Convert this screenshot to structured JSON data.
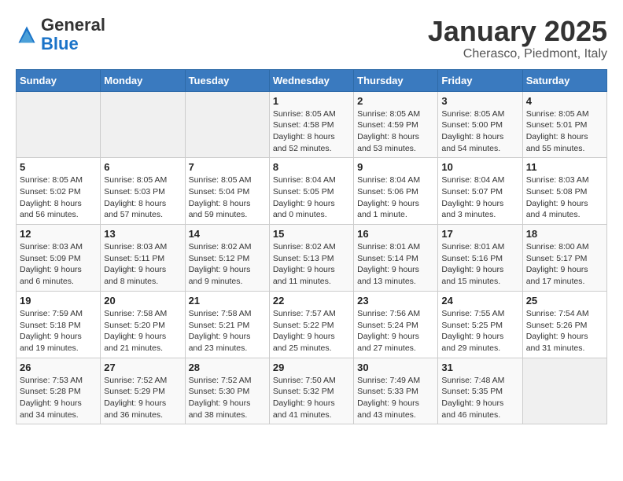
{
  "header": {
    "logo_general": "General",
    "logo_blue": "Blue",
    "title": "January 2025",
    "subtitle": "Cherasco, Piedmont, Italy"
  },
  "weekdays": [
    "Sunday",
    "Monday",
    "Tuesday",
    "Wednesday",
    "Thursday",
    "Friday",
    "Saturday"
  ],
  "weeks": [
    [
      {
        "day": "",
        "info": ""
      },
      {
        "day": "",
        "info": ""
      },
      {
        "day": "",
        "info": ""
      },
      {
        "day": "1",
        "info": "Sunrise: 8:05 AM\nSunset: 4:58 PM\nDaylight: 8 hours and 52 minutes."
      },
      {
        "day": "2",
        "info": "Sunrise: 8:05 AM\nSunset: 4:59 PM\nDaylight: 8 hours and 53 minutes."
      },
      {
        "day": "3",
        "info": "Sunrise: 8:05 AM\nSunset: 5:00 PM\nDaylight: 8 hours and 54 minutes."
      },
      {
        "day": "4",
        "info": "Sunrise: 8:05 AM\nSunset: 5:01 PM\nDaylight: 8 hours and 55 minutes."
      }
    ],
    [
      {
        "day": "5",
        "info": "Sunrise: 8:05 AM\nSunset: 5:02 PM\nDaylight: 8 hours and 56 minutes."
      },
      {
        "day": "6",
        "info": "Sunrise: 8:05 AM\nSunset: 5:03 PM\nDaylight: 8 hours and 57 minutes."
      },
      {
        "day": "7",
        "info": "Sunrise: 8:05 AM\nSunset: 5:04 PM\nDaylight: 8 hours and 59 minutes."
      },
      {
        "day": "8",
        "info": "Sunrise: 8:04 AM\nSunset: 5:05 PM\nDaylight: 9 hours and 0 minutes."
      },
      {
        "day": "9",
        "info": "Sunrise: 8:04 AM\nSunset: 5:06 PM\nDaylight: 9 hours and 1 minute."
      },
      {
        "day": "10",
        "info": "Sunrise: 8:04 AM\nSunset: 5:07 PM\nDaylight: 9 hours and 3 minutes."
      },
      {
        "day": "11",
        "info": "Sunrise: 8:03 AM\nSunset: 5:08 PM\nDaylight: 9 hours and 4 minutes."
      }
    ],
    [
      {
        "day": "12",
        "info": "Sunrise: 8:03 AM\nSunset: 5:09 PM\nDaylight: 9 hours and 6 minutes."
      },
      {
        "day": "13",
        "info": "Sunrise: 8:03 AM\nSunset: 5:11 PM\nDaylight: 9 hours and 8 minutes."
      },
      {
        "day": "14",
        "info": "Sunrise: 8:02 AM\nSunset: 5:12 PM\nDaylight: 9 hours and 9 minutes."
      },
      {
        "day": "15",
        "info": "Sunrise: 8:02 AM\nSunset: 5:13 PM\nDaylight: 9 hours and 11 minutes."
      },
      {
        "day": "16",
        "info": "Sunrise: 8:01 AM\nSunset: 5:14 PM\nDaylight: 9 hours and 13 minutes."
      },
      {
        "day": "17",
        "info": "Sunrise: 8:01 AM\nSunset: 5:16 PM\nDaylight: 9 hours and 15 minutes."
      },
      {
        "day": "18",
        "info": "Sunrise: 8:00 AM\nSunset: 5:17 PM\nDaylight: 9 hours and 17 minutes."
      }
    ],
    [
      {
        "day": "19",
        "info": "Sunrise: 7:59 AM\nSunset: 5:18 PM\nDaylight: 9 hours and 19 minutes."
      },
      {
        "day": "20",
        "info": "Sunrise: 7:58 AM\nSunset: 5:20 PM\nDaylight: 9 hours and 21 minutes."
      },
      {
        "day": "21",
        "info": "Sunrise: 7:58 AM\nSunset: 5:21 PM\nDaylight: 9 hours and 23 minutes."
      },
      {
        "day": "22",
        "info": "Sunrise: 7:57 AM\nSunset: 5:22 PM\nDaylight: 9 hours and 25 minutes."
      },
      {
        "day": "23",
        "info": "Sunrise: 7:56 AM\nSunset: 5:24 PM\nDaylight: 9 hours and 27 minutes."
      },
      {
        "day": "24",
        "info": "Sunrise: 7:55 AM\nSunset: 5:25 PM\nDaylight: 9 hours and 29 minutes."
      },
      {
        "day": "25",
        "info": "Sunrise: 7:54 AM\nSunset: 5:26 PM\nDaylight: 9 hours and 31 minutes."
      }
    ],
    [
      {
        "day": "26",
        "info": "Sunrise: 7:53 AM\nSunset: 5:28 PM\nDaylight: 9 hours and 34 minutes."
      },
      {
        "day": "27",
        "info": "Sunrise: 7:52 AM\nSunset: 5:29 PM\nDaylight: 9 hours and 36 minutes."
      },
      {
        "day": "28",
        "info": "Sunrise: 7:52 AM\nSunset: 5:30 PM\nDaylight: 9 hours and 38 minutes."
      },
      {
        "day": "29",
        "info": "Sunrise: 7:50 AM\nSunset: 5:32 PM\nDaylight: 9 hours and 41 minutes."
      },
      {
        "day": "30",
        "info": "Sunrise: 7:49 AM\nSunset: 5:33 PM\nDaylight: 9 hours and 43 minutes."
      },
      {
        "day": "31",
        "info": "Sunrise: 7:48 AM\nSunset: 5:35 PM\nDaylight: 9 hours and 46 minutes."
      },
      {
        "day": "",
        "info": ""
      }
    ]
  ]
}
